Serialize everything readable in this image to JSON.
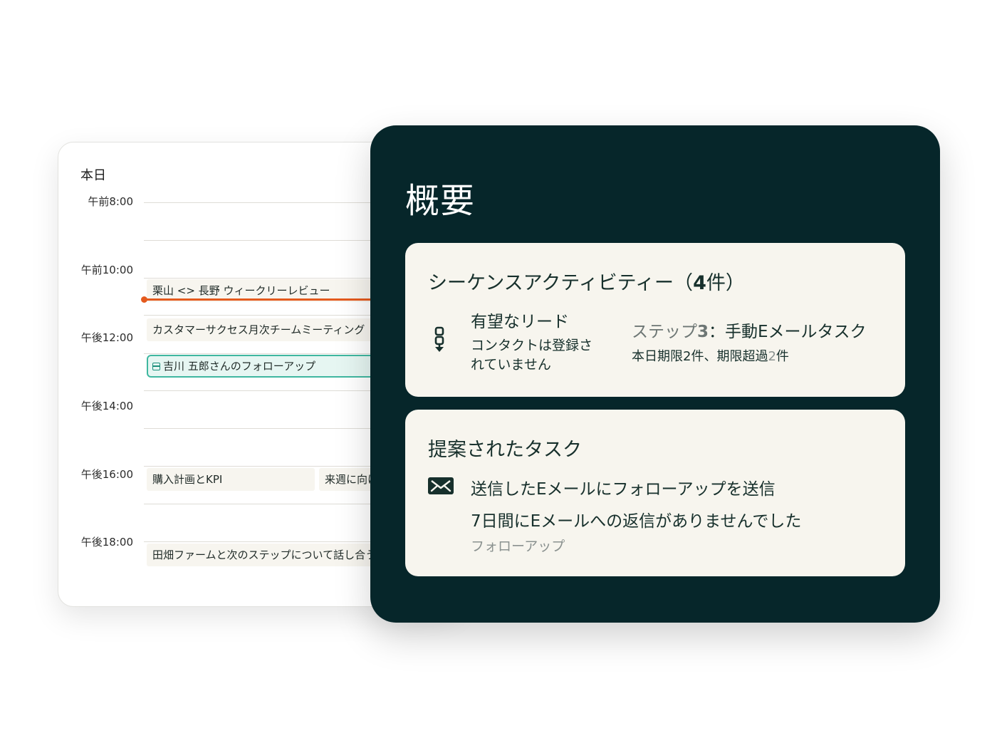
{
  "calendar": {
    "title": "本日",
    "times": [
      "午前8:00",
      "午前10:00",
      "午後12:00",
      "午後14:00",
      "午後16:00",
      "午後18:00"
    ],
    "events": {
      "review": "栗山 <> 長野 ウィークリーレビュー",
      "cs_meeting": "カスタマーサクセス月次チームミーティング",
      "followup_task": "吉川 五郎さんのフォローアップ",
      "purchase_plan": "購入計画とKPI",
      "next_week": "来週に向けて",
      "tabata": "田畑ファームと次のステップについて話し合う"
    }
  },
  "overview": {
    "title": "概要",
    "sequence": {
      "heading_prefix": "シーケンスアクティビティー（",
      "count": "4",
      "heading_suffix": "件）",
      "lead_title": "有望なリード",
      "lead_sub": "コンタクトは登録されていません",
      "step_prefix": "ステップ",
      "step_number": "3",
      "step_rest": "：手動Eメールタスク",
      "due_prefix": "本日期限2件、期限超過",
      "overdue_count": "2",
      "due_suffix": "件"
    },
    "suggested": {
      "heading": "提案されたタスク",
      "title": "送信したEメールにフォローアップを送信",
      "description": "7日間にEメールへの返信がありませんでした",
      "tag": "フォローアップ"
    }
  },
  "colors": {
    "panel": "#06262a",
    "card": "#f7f5ee",
    "now_line": "#e45a1e",
    "task_accent": "#3fb7a0"
  },
  "icons": {
    "sequence": "sequence-steps-icon",
    "mail": "envelope-icon",
    "task": "task-icon"
  }
}
